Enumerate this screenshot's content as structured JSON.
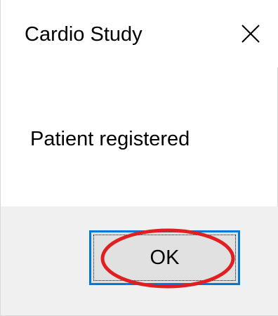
{
  "dialog": {
    "title": "Cardio Study",
    "close_icon": "close-icon",
    "message": "Patient registered",
    "ok_label": "OK"
  },
  "annotation": {
    "highlight_color": "#e02020",
    "shape": "ellipse"
  },
  "colors": {
    "background": "#ffffff",
    "footer": "#f0f0f0",
    "button_face": "#e1e1e1",
    "button_focus_border": "#0078d7"
  }
}
